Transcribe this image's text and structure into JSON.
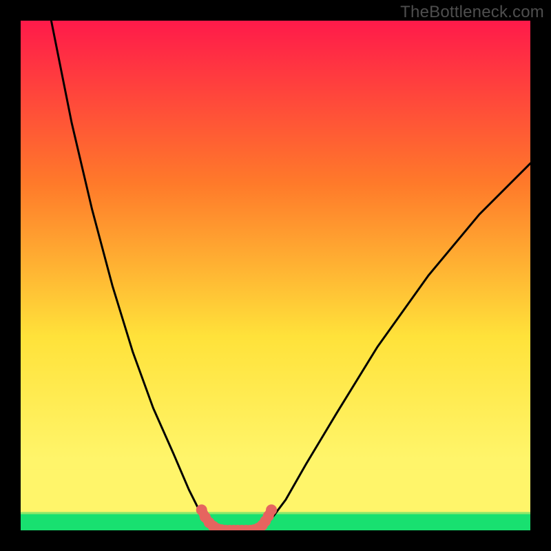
{
  "watermark": "TheBottleneck.com",
  "chart_data": {
    "type": "line",
    "title": "",
    "xlabel": "",
    "ylabel": "",
    "xlim": [
      0,
      100
    ],
    "ylim": [
      0,
      100
    ],
    "background_gradient": {
      "top": "#ff1a4a",
      "mid_upper": "#ff7a2a",
      "mid": "#ffe23a",
      "band": "#fff56a",
      "bottom": "#18e070"
    },
    "series": [
      {
        "name": "left-curve",
        "stroke": "#000000",
        "x": [
          6,
          10,
          14,
          18,
          22,
          26,
          30,
          33,
          35,
          37,
          38
        ],
        "y": [
          100,
          80,
          63,
          48,
          35,
          24,
          15,
          8,
          4,
          1,
          0
        ]
      },
      {
        "name": "right-curve",
        "stroke": "#000000",
        "x": [
          47,
          49,
          52,
          56,
          62,
          70,
          80,
          90,
          100
        ],
        "y": [
          0,
          2,
          6,
          13,
          23,
          36,
          50,
          62,
          72
        ]
      },
      {
        "name": "valley-marker",
        "stroke": "#e6645f",
        "x": [
          35.5,
          36.2,
          37.0,
          37.8,
          38.6,
          39.4,
          40.2,
          41.0,
          41.8,
          42.6,
          43.4,
          44.2,
          45.0,
          45.8,
          46.6,
          47.4,
          48.0,
          48.6,
          49.2
        ],
        "y": [
          4.0,
          2.6,
          1.5,
          0.8,
          0.3,
          0.1,
          0.0,
          0.0,
          0.0,
          0.0,
          0.0,
          0.0,
          0.0,
          0.1,
          0.4,
          1.0,
          1.8,
          2.8,
          4.0
        ]
      }
    ],
    "green_band": {
      "y0": 0,
      "y1": 3.2
    },
    "pale_band": {
      "y0": 3.2,
      "y1": 12
    }
  }
}
